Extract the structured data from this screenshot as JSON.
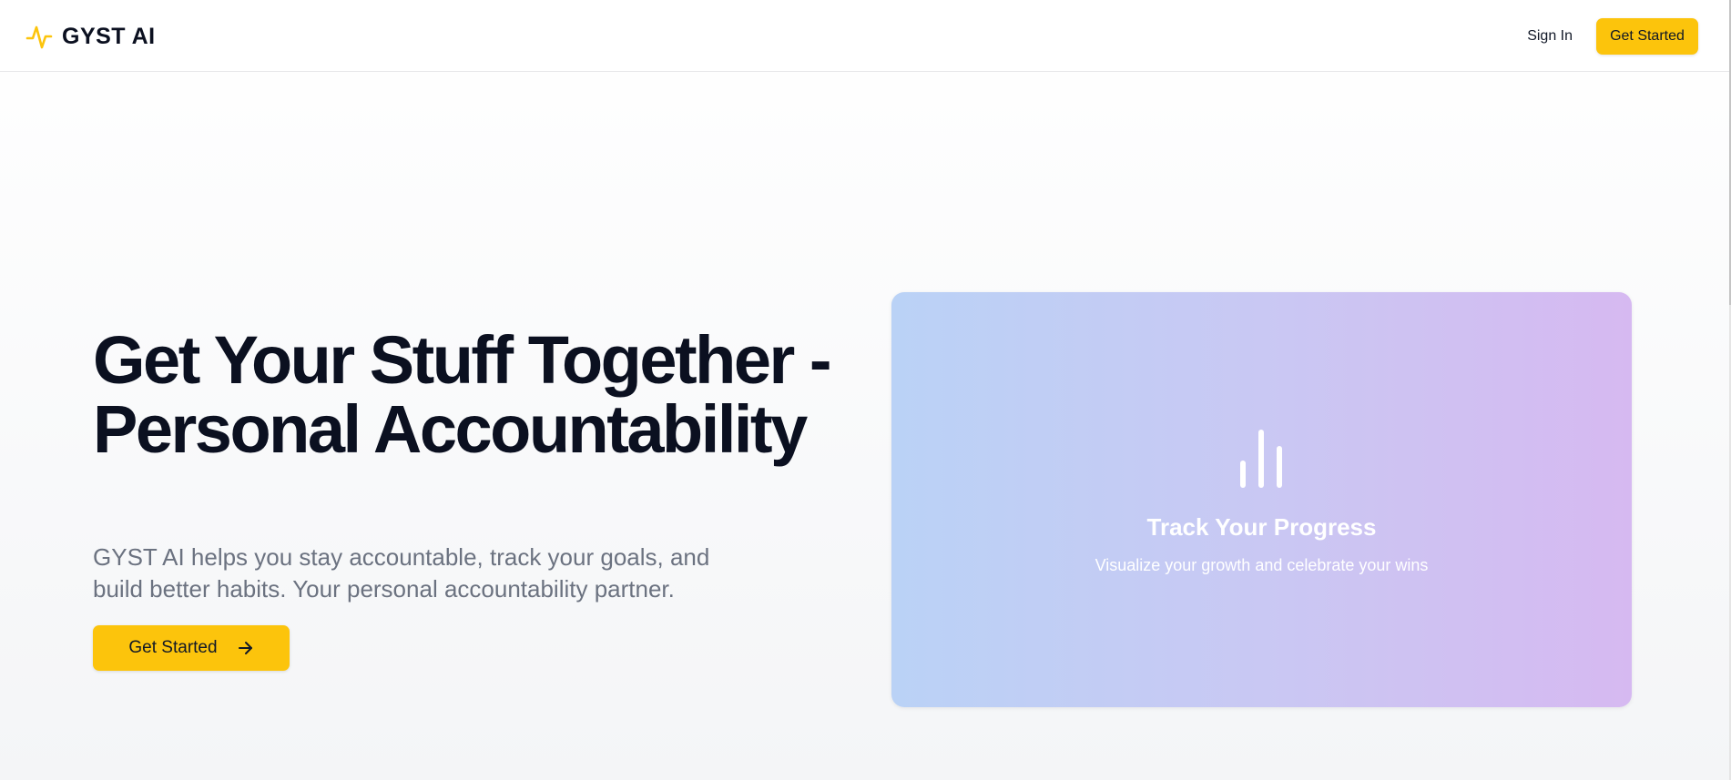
{
  "header": {
    "brand": "GYST AI",
    "brand_icon": "activity-pulse-icon",
    "nav": {
      "signin_label": "Sign In",
      "cta_label": "Get Started"
    }
  },
  "hero": {
    "title": "Get Your Stuff Together - Personal Accountability",
    "subtitle": "GYST AI helps you stay accountable, track your goals, and build better habits. Your personal accountability partner.",
    "cta_label": "Get Started",
    "cta_icon": "arrow-right-icon"
  },
  "feature_card": {
    "icon": "bar-chart-icon",
    "title": "Track Your Progress",
    "subtitle": "Visualize your growth and celebrate your wins"
  },
  "colors": {
    "accent": "#fcc40c",
    "heading": "#0b1020",
    "muted_text": "#6b7280",
    "card_gradient_start": "#bad2f6",
    "card_gradient_end": "#d6b9f1"
  }
}
